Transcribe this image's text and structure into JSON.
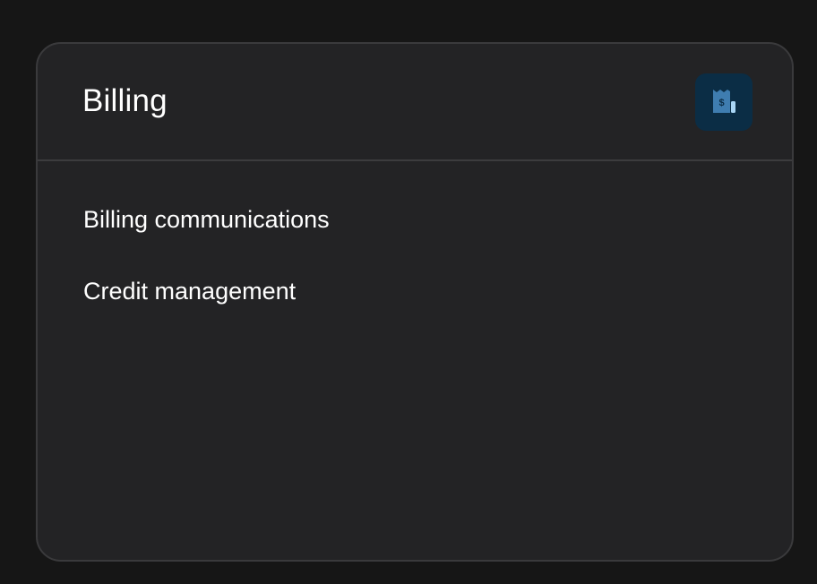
{
  "card": {
    "title": "Billing",
    "icon": "receipt-dollar-icon",
    "accent_bg": "#0b2d45",
    "accent_fg": "#4a8fc2",
    "links": [
      {
        "label": "Billing communications"
      },
      {
        "label": "Credit management"
      }
    ]
  }
}
